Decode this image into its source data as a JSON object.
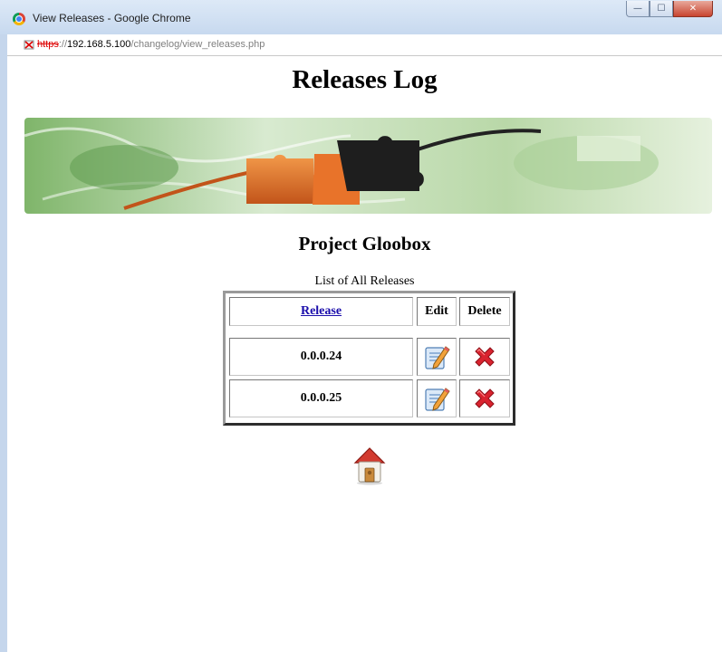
{
  "window": {
    "title": "View Releases - Google Chrome",
    "controls": {
      "minimize": "—",
      "maximize": "☐",
      "close": "✕"
    }
  },
  "address_bar": {
    "scheme": "https",
    "separator": "://",
    "host": "192.168.5.100",
    "path": "/changelog/view_releases.php",
    "security_icon": "broken-lock-icon"
  },
  "page": {
    "title": "Releases Log",
    "banner_icon": "puzzle-world-banner-image",
    "project_title": "Project Gloobox",
    "list_caption": "List of All Releases"
  },
  "table": {
    "headers": {
      "release": "Release",
      "edit": "Edit",
      "delete": "Delete"
    },
    "rows": [
      {
        "release": "0.0.0.24",
        "edit_icon": "edit-icon",
        "delete_icon": "delete-icon"
      },
      {
        "release": "0.0.0.25",
        "edit_icon": "edit-icon",
        "delete_icon": "delete-icon"
      }
    ]
  },
  "home": {
    "icon": "home-icon"
  },
  "colors": {
    "link": "#1a0dab",
    "delete_red": "#d9232f",
    "puzzle_orange": "#e8732a",
    "banner_green": "#8cc07a"
  }
}
